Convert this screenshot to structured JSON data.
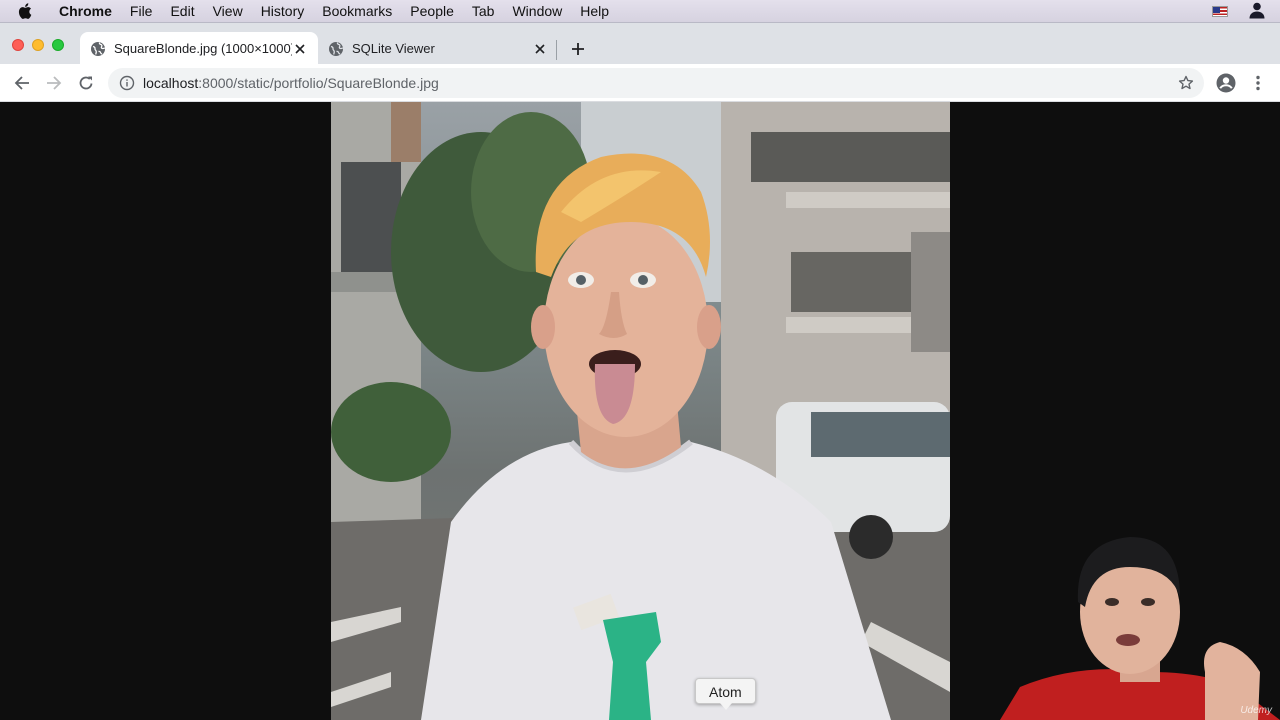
{
  "menubar": {
    "apple_icon": "apple-icon",
    "app_name": "Chrome",
    "items": [
      "File",
      "Edit",
      "View",
      "History",
      "Bookmarks",
      "People",
      "Tab",
      "Window",
      "Help"
    ],
    "input_source_icon": "us-flag-icon",
    "user_icon": "user-silhouette-icon"
  },
  "tabs": [
    {
      "title": "SquareBlonde.jpg (1000×1000)",
      "icon": "globe-icon",
      "active": true
    },
    {
      "title": "SQLite Viewer",
      "icon": "globe-icon",
      "active": false
    }
  ],
  "toolbar": {
    "url_host": "localhost",
    "url_rest": ":8000/static/portfolio/SquareBlonde.jpg",
    "icons": [
      "back-arrow-icon",
      "forward-arrow-icon",
      "reload-icon",
      "info-icon",
      "star-icon",
      "account-icon",
      "kebab-menu-icon"
    ]
  },
  "content": {
    "image_subject": "photo",
    "tooltip": "Atom",
    "watermark": "Udemy"
  },
  "colors": {
    "tab_strip": "#dee1e6",
    "omnibox": "#f1f3f4",
    "content_bg": "#0e0e0e"
  }
}
